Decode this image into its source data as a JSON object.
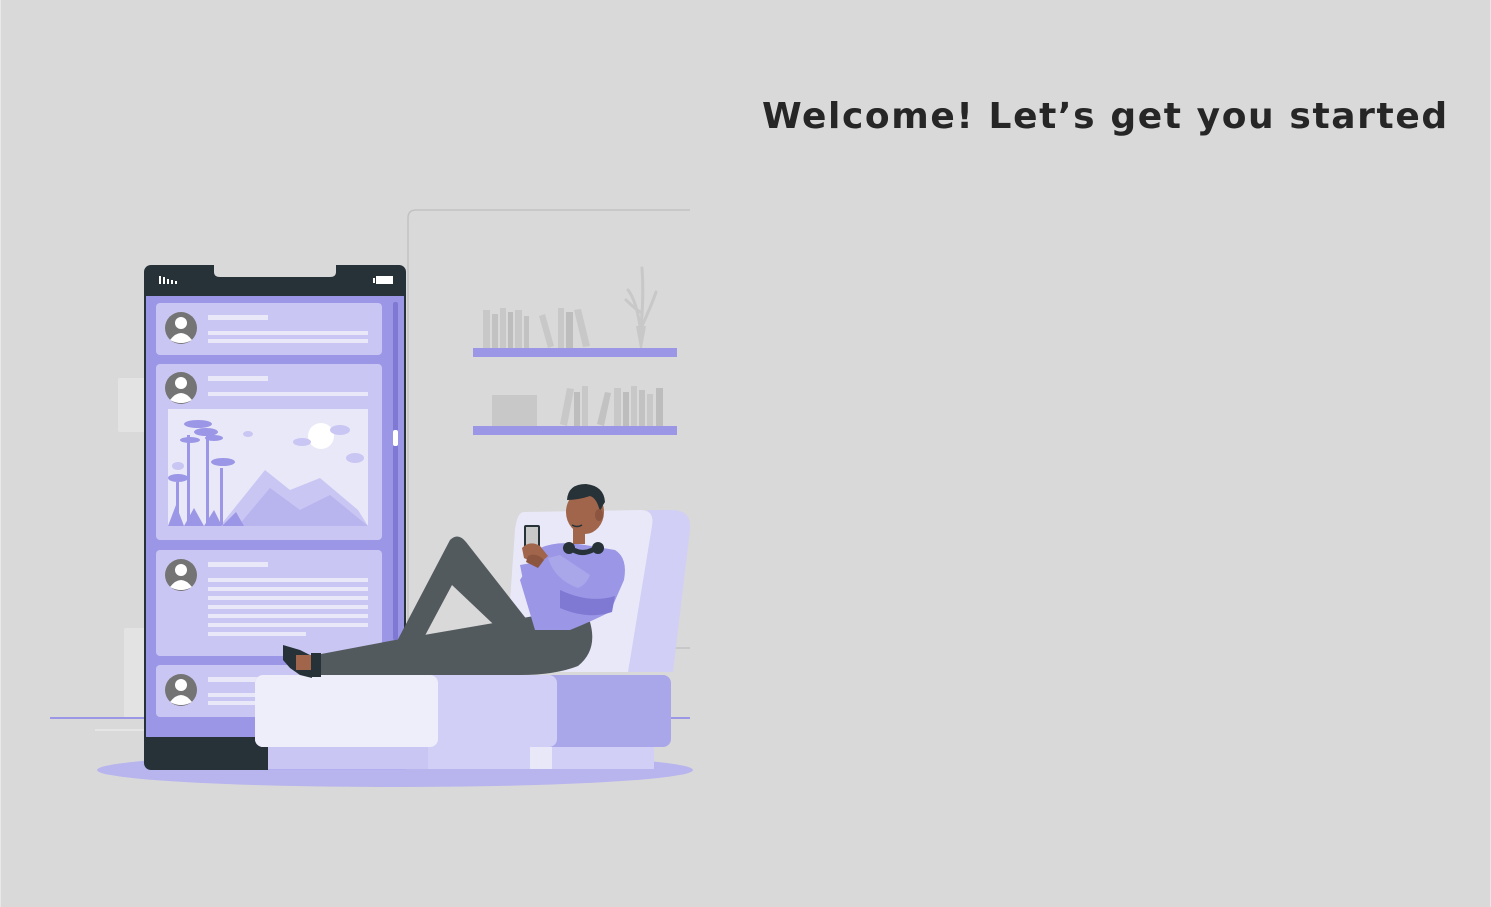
{
  "heading": {
    "title": "Welcome! Let’s get you started"
  },
  "illustration": {
    "name": "person-relaxing-with-phone",
    "colors": {
      "background": "#d9d9d9",
      "accent": "#9b96e6",
      "accent_light": "#c9c6f3",
      "accent_pale": "#e9e8f8",
      "phone_frame": "#263238",
      "skin": "#a0654a",
      "pants": "#535a5e"
    }
  }
}
